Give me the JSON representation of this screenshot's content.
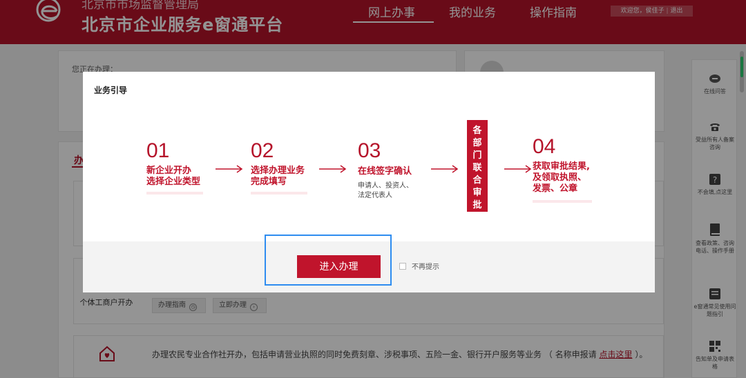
{
  "header": {
    "agency": "北京市市场监督管理局",
    "platform": "北京市企业服务e窗通平台",
    "nav": [
      {
        "label": "网上办事",
        "active": true
      },
      {
        "label": "我的业务",
        "active": false
      },
      {
        "label": "操作指南",
        "active": false
      }
    ],
    "user_greeting": "欢迎您，侯佳子",
    "logout": "退出",
    "brand_color": "#b5132a"
  },
  "page": {
    "current_label": "您正在办理：",
    "tab_fragment": "办",
    "services": [
      {
        "name": "个体工商户开办",
        "guide_label": "办理指南",
        "apply_label": "立即办理"
      }
    ],
    "coop": {
      "desc": "办理农民专业合作社开办，包括申请营业执照的同时免费刻章、涉税事项、五险一金、银行开户服务等业务 （ 名称申报请",
      "link": "点击这里",
      "tail": "）。"
    }
  },
  "sidebar": {
    "items": [
      {
        "label": "在线问答",
        "icon": "chat-icon"
      },
      {
        "label": "受益所有人备案咨询",
        "icon": "phone-icon"
      },
      {
        "label": "不会填,点这里",
        "icon": "question-icon"
      },
      {
        "label": "查看政策、咨询电话、操作手册",
        "icon": "book-icon"
      },
      {
        "label": "e窗通常见使用问题指引",
        "icon": "guide-icon"
      },
      {
        "label": "告知单及申请表格",
        "icon": "qrcode-icon"
      }
    ]
  },
  "modal": {
    "title": "业务引导",
    "steps": [
      {
        "num": "01",
        "title": [
          "新企业开办",
          "选择企业类型"
        ],
        "sub": []
      },
      {
        "num": "02",
        "title": [
          "选择办理业务",
          "完成填写"
        ],
        "sub": []
      },
      {
        "num": "03",
        "title": [
          "在线签字确认"
        ],
        "sub": [
          "申请人、投资人、",
          "法定代表人"
        ]
      },
      {
        "num": "04",
        "title": [
          "获取审批结果,",
          "及领取执照、",
          "发票、公章"
        ],
        "sub": []
      }
    ],
    "joint_review": [
      "各",
      "部",
      "门",
      "联",
      "合",
      "审",
      "批"
    ],
    "enter_button": "进入办理",
    "no_remind": "不再提示",
    "accent_color": "#c0142c"
  }
}
